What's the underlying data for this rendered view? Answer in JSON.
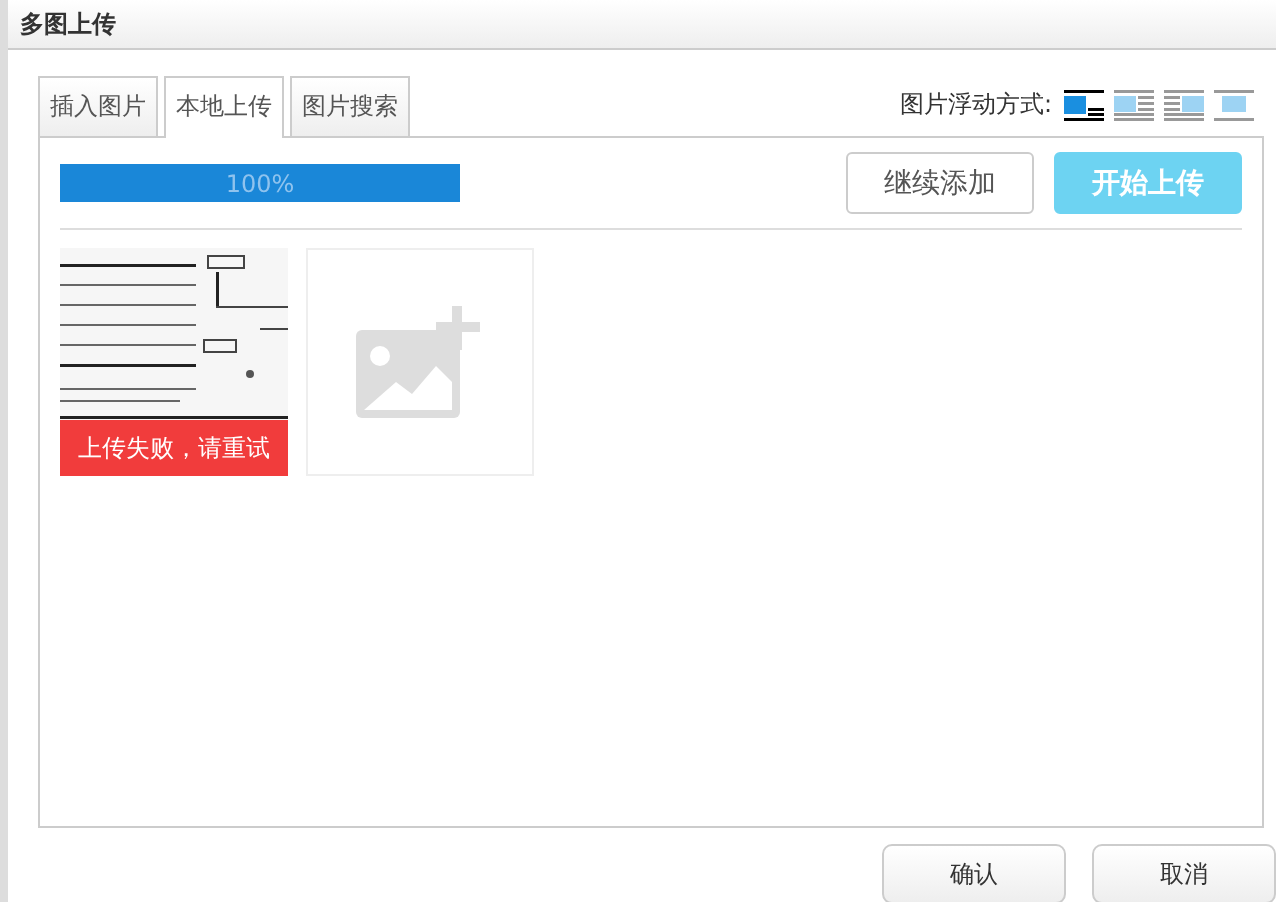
{
  "window": {
    "title": "多图上传"
  },
  "tabs": [
    {
      "label": "插入图片",
      "selected": false
    },
    {
      "label": "本地上传",
      "selected": true
    },
    {
      "label": "图片搜索",
      "selected": false
    }
  ],
  "float": {
    "label": "图片浮动方式:",
    "options": [
      {
        "kind": "none",
        "selected": true
      },
      {
        "kind": "left",
        "selected": false
      },
      {
        "kind": "right",
        "selected": false
      },
      {
        "kind": "center",
        "selected": false
      }
    ]
  },
  "progress": {
    "level": 1,
    "reading": "100%"
  },
  "buttons": {
    "add": "继续添加",
    "start": "开始上传"
  },
  "files": [
    {
      "kind": "picture",
      "error": "上传失败，请重试"
    }
  ],
  "footer": [
    "确认",
    "取消"
  ]
}
